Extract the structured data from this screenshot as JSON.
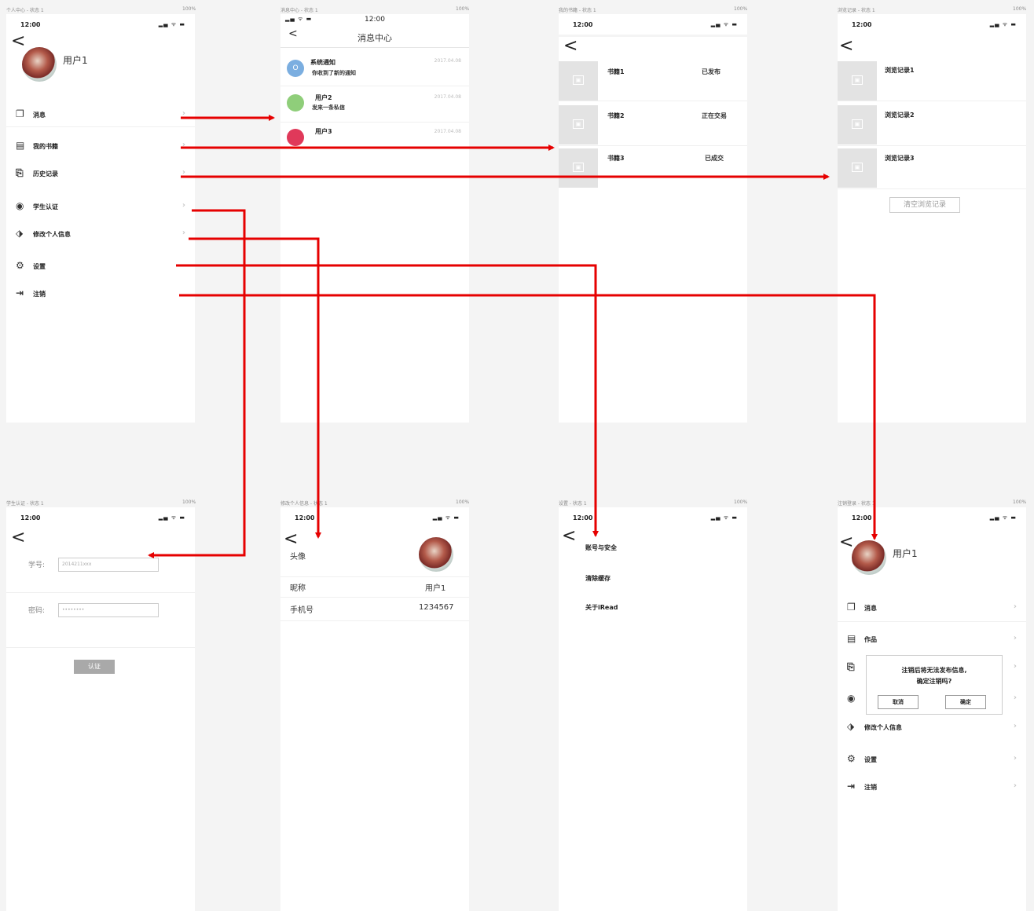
{
  "frames": [
    {
      "label": "个人中心 - 状态 1",
      "pct": "100%"
    },
    {
      "label": "消息中心 - 状态 1",
      "pct": "100%"
    },
    {
      "label": "我的书籍 - 状态 1",
      "pct": "100%"
    },
    {
      "label": "浏览记录 - 状态 1",
      "pct": "100%"
    },
    {
      "label": "学生认证 - 状态 1",
      "pct": "100%"
    },
    {
      "label": "修改个人信息 - 状态 1",
      "pct": "100%"
    },
    {
      "label": "设置 - 状态 1",
      "pct": "100%"
    },
    {
      "label": "注销登录 - 状态 1",
      "pct": "100%"
    }
  ],
  "status_time": "12:00",
  "status_icons": "▂▄ ᯤ ▬",
  "back_glyph": "<",
  "chevron": "›",
  "profile": {
    "username": "用户1",
    "menu": [
      {
        "icon": "❐",
        "label": "消息"
      },
      {
        "icon": "▤",
        "label": "我的书籍"
      },
      {
        "icon": "⎘",
        "label": "历史记录"
      },
      {
        "icon": "◉",
        "label": "学生认证"
      },
      {
        "icon": "⬗",
        "label": "修改个人信息"
      },
      {
        "icon": "⚙",
        "label": "设置"
      },
      {
        "icon": "⇥",
        "label": "注销"
      }
    ]
  },
  "messages": {
    "title": "消息中心",
    "items": [
      {
        "title": "系统通知",
        "sub": "你收到了新的通知",
        "date": "2017.04.08",
        "badge": "O",
        "color": "#7baee0"
      },
      {
        "title": "用户2",
        "sub": "发来一条私信",
        "date": "2017.04.08",
        "badge": "",
        "color": "#8fce7a"
      },
      {
        "title": "用户3",
        "sub": "",
        "date": "2017.04.08",
        "badge": "",
        "color": "#e0395a"
      }
    ]
  },
  "books": {
    "items": [
      {
        "title": "书籍1",
        "status": "已发布"
      },
      {
        "title": "书籍2",
        "status": "正在交易"
      },
      {
        "title": "书籍3",
        "status": "已成交"
      }
    ],
    "thumb_glyph": "▣"
  },
  "history": {
    "items": [
      "浏览记录1",
      "浏览记录2",
      "浏览记录3"
    ],
    "clear_label": "清空浏览记录"
  },
  "auth": {
    "id_label": "学号:",
    "id_value": "2014211xxx",
    "pwd_label": "密码:",
    "pwd_value": "••••••••",
    "button": "认证"
  },
  "edit": {
    "avatar_label": "头像",
    "nickname_label": "昵称",
    "nickname_value": "用户1",
    "phone_label": "手机号",
    "phone_value": "1234567"
  },
  "settings": {
    "items": [
      "账号与安全",
      "清除缓存",
      "关于iRead"
    ]
  },
  "logout": {
    "username": "用户1",
    "menu": [
      {
        "icon": "❐",
        "label": "消息"
      },
      {
        "icon": "▤",
        "label": "作品"
      },
      {
        "icon": "⎘",
        "label": ""
      },
      {
        "icon": "◉",
        "label": ""
      },
      {
        "icon": "⬗",
        "label": "修改个人信息"
      },
      {
        "icon": "⚙",
        "label": "设置"
      },
      {
        "icon": "⇥",
        "label": "注销"
      }
    ],
    "dialog_line1": "注销后将无法发布信息,",
    "dialog_line2": "确定注销吗?",
    "cancel": "取消",
    "confirm": "确定"
  },
  "colors": {
    "arrow": "#e60000",
    "screen": "#ffffff",
    "background": "#f4f4f4"
  }
}
